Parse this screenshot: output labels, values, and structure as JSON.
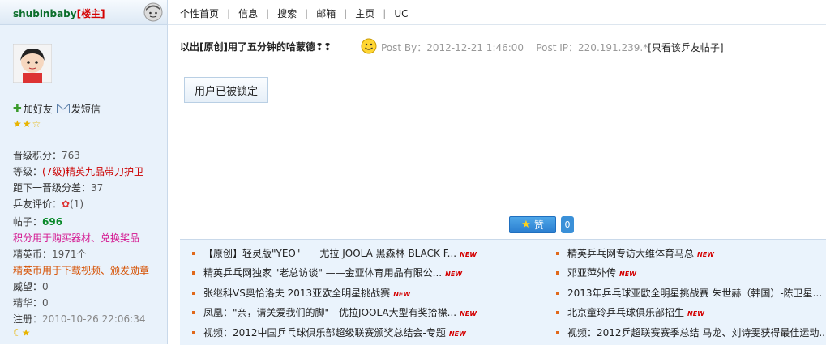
{
  "sidebar": {
    "username": "shubinbaby",
    "role": "[楼主]",
    "add_friend": "加好友",
    "send_message": "发短信",
    "stars": 3,
    "stats": {
      "level_points_label": "晋级积分：",
      "level_points": "763",
      "grade_label": "等级：",
      "grade": "(7级)精英九品带刀护卫",
      "next_level_label": "距下一晋级分差：",
      "next_level": "37",
      "rating_label": "乒友评价：",
      "rating": "(1)",
      "posts_label": "帖子：",
      "posts": "696",
      "points_note": "积分用于购买器材、兑换奖品",
      "coins_label": "精英币：",
      "coins": "1971个",
      "coins_note": "精英币用于下载视频、颁发勋章",
      "prestige_label": "威望：",
      "prestige": "0",
      "essence_label": "精华：",
      "essence": "0",
      "registered_label": "注册：",
      "registered": "2010-10-26 22:06:34"
    }
  },
  "topnav": {
    "items": [
      "个性首页",
      "信息",
      "搜索",
      "邮箱",
      "主页",
      "UC"
    ]
  },
  "post": {
    "title": "以出[原创]用了五分钟的哈蒙德❢❢",
    "posted_by": "Post By：2012-12-21 1:46:00",
    "post_ip": "Post IP：220.191.239.*",
    "only_this_user": "[只看该乒友帖子]",
    "locked_text": "用户已被锁定"
  },
  "like": {
    "label": "赞",
    "count": "0"
  },
  "related": {
    "left": [
      "【原创】轻灵版\"YEO\"－－尤拉 JOOLA 黑森林 BLACK F...",
      "精英乒乓网独家 \"老总访谈\" ——金亚体育用品有限公...",
      "张继科VS奥恰洛夫 2013亚欧全明星挑战赛",
      "凤凰：\"亲，请关爱我们的脚\"—优拉JOOLA大型有奖拾襟...",
      "视频：2012中国乒乓球俱乐部超级联赛颁奖总结会-专题"
    ],
    "right": [
      "精英乒乓网专访大维体育马总",
      "邓亚萍外传",
      "2013年乒乓球亚欧全明星挑战赛 朱世赫（韩国）-陈卫星...",
      "北京童玲乒乓球俱乐部招生",
      "视频：2012乒超联赛赛季总结 马龙、刘诗雯获得最佳运动..."
    ],
    "new_badge": "NEW"
  }
}
